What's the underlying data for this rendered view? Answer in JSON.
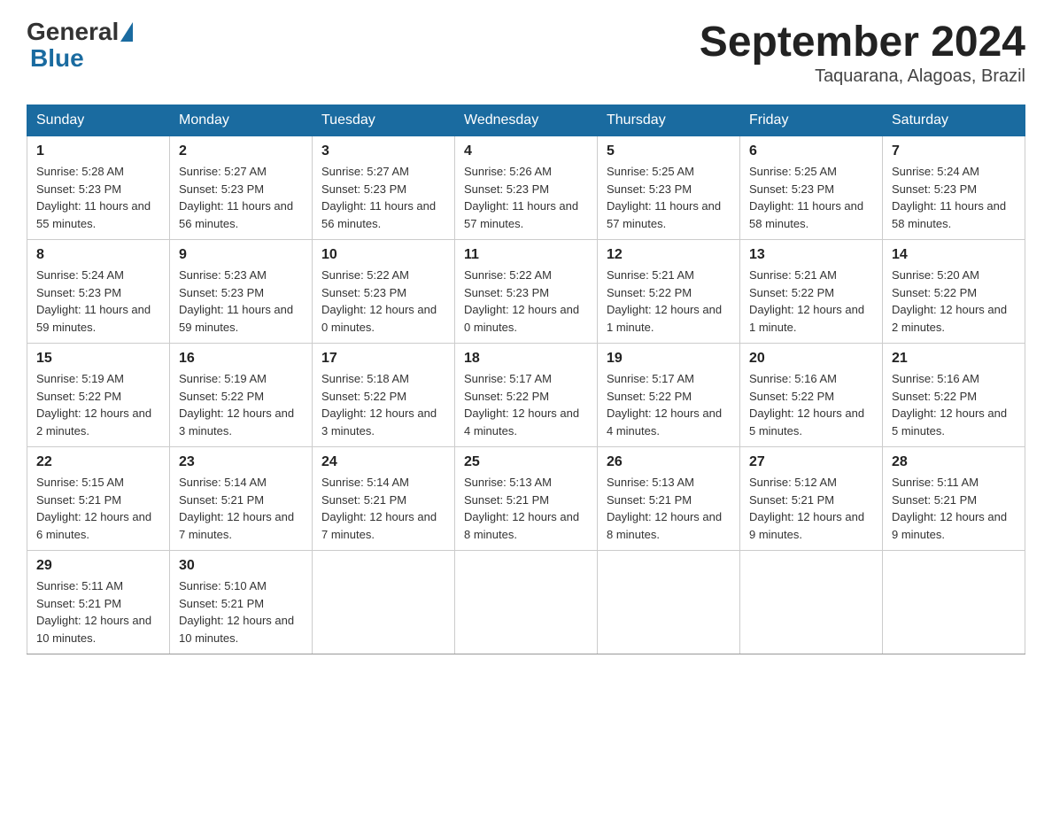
{
  "logo": {
    "general": "General",
    "blue": "Blue",
    "arrow": "▶"
  },
  "header": {
    "month_title": "September 2024",
    "location": "Taquarana, Alagoas, Brazil"
  },
  "days_of_week": [
    "Sunday",
    "Monday",
    "Tuesday",
    "Wednesday",
    "Thursday",
    "Friday",
    "Saturday"
  ],
  "weeks": [
    [
      {
        "day": "1",
        "sunrise": "5:28 AM",
        "sunset": "5:23 PM",
        "daylight": "11 hours and 55 minutes."
      },
      {
        "day": "2",
        "sunrise": "5:27 AM",
        "sunset": "5:23 PM",
        "daylight": "11 hours and 56 minutes."
      },
      {
        "day": "3",
        "sunrise": "5:27 AM",
        "sunset": "5:23 PM",
        "daylight": "11 hours and 56 minutes."
      },
      {
        "day": "4",
        "sunrise": "5:26 AM",
        "sunset": "5:23 PM",
        "daylight": "11 hours and 57 minutes."
      },
      {
        "day": "5",
        "sunrise": "5:25 AM",
        "sunset": "5:23 PM",
        "daylight": "11 hours and 57 minutes."
      },
      {
        "day": "6",
        "sunrise": "5:25 AM",
        "sunset": "5:23 PM",
        "daylight": "11 hours and 58 minutes."
      },
      {
        "day": "7",
        "sunrise": "5:24 AM",
        "sunset": "5:23 PM",
        "daylight": "11 hours and 58 minutes."
      }
    ],
    [
      {
        "day": "8",
        "sunrise": "5:24 AM",
        "sunset": "5:23 PM",
        "daylight": "11 hours and 59 minutes."
      },
      {
        "day": "9",
        "sunrise": "5:23 AM",
        "sunset": "5:23 PM",
        "daylight": "11 hours and 59 minutes."
      },
      {
        "day": "10",
        "sunrise": "5:22 AM",
        "sunset": "5:23 PM",
        "daylight": "12 hours and 0 minutes."
      },
      {
        "day": "11",
        "sunrise": "5:22 AM",
        "sunset": "5:23 PM",
        "daylight": "12 hours and 0 minutes."
      },
      {
        "day": "12",
        "sunrise": "5:21 AM",
        "sunset": "5:22 PM",
        "daylight": "12 hours and 1 minute."
      },
      {
        "day": "13",
        "sunrise": "5:21 AM",
        "sunset": "5:22 PM",
        "daylight": "12 hours and 1 minute."
      },
      {
        "day": "14",
        "sunrise": "5:20 AM",
        "sunset": "5:22 PM",
        "daylight": "12 hours and 2 minutes."
      }
    ],
    [
      {
        "day": "15",
        "sunrise": "5:19 AM",
        "sunset": "5:22 PM",
        "daylight": "12 hours and 2 minutes."
      },
      {
        "day": "16",
        "sunrise": "5:19 AM",
        "sunset": "5:22 PM",
        "daylight": "12 hours and 3 minutes."
      },
      {
        "day": "17",
        "sunrise": "5:18 AM",
        "sunset": "5:22 PM",
        "daylight": "12 hours and 3 minutes."
      },
      {
        "day": "18",
        "sunrise": "5:17 AM",
        "sunset": "5:22 PM",
        "daylight": "12 hours and 4 minutes."
      },
      {
        "day": "19",
        "sunrise": "5:17 AM",
        "sunset": "5:22 PM",
        "daylight": "12 hours and 4 minutes."
      },
      {
        "day": "20",
        "sunrise": "5:16 AM",
        "sunset": "5:22 PM",
        "daylight": "12 hours and 5 minutes."
      },
      {
        "day": "21",
        "sunrise": "5:16 AM",
        "sunset": "5:22 PM",
        "daylight": "12 hours and 5 minutes."
      }
    ],
    [
      {
        "day": "22",
        "sunrise": "5:15 AM",
        "sunset": "5:21 PM",
        "daylight": "12 hours and 6 minutes."
      },
      {
        "day": "23",
        "sunrise": "5:14 AM",
        "sunset": "5:21 PM",
        "daylight": "12 hours and 7 minutes."
      },
      {
        "day": "24",
        "sunrise": "5:14 AM",
        "sunset": "5:21 PM",
        "daylight": "12 hours and 7 minutes."
      },
      {
        "day": "25",
        "sunrise": "5:13 AM",
        "sunset": "5:21 PM",
        "daylight": "12 hours and 8 minutes."
      },
      {
        "day": "26",
        "sunrise": "5:13 AM",
        "sunset": "5:21 PM",
        "daylight": "12 hours and 8 minutes."
      },
      {
        "day": "27",
        "sunrise": "5:12 AM",
        "sunset": "5:21 PM",
        "daylight": "12 hours and 9 minutes."
      },
      {
        "day": "28",
        "sunrise": "5:11 AM",
        "sunset": "5:21 PM",
        "daylight": "12 hours and 9 minutes."
      }
    ],
    [
      {
        "day": "29",
        "sunrise": "5:11 AM",
        "sunset": "5:21 PM",
        "daylight": "12 hours and 10 minutes."
      },
      {
        "day": "30",
        "sunrise": "5:10 AM",
        "sunset": "5:21 PM",
        "daylight": "12 hours and 10 minutes."
      },
      null,
      null,
      null,
      null,
      null
    ]
  ]
}
